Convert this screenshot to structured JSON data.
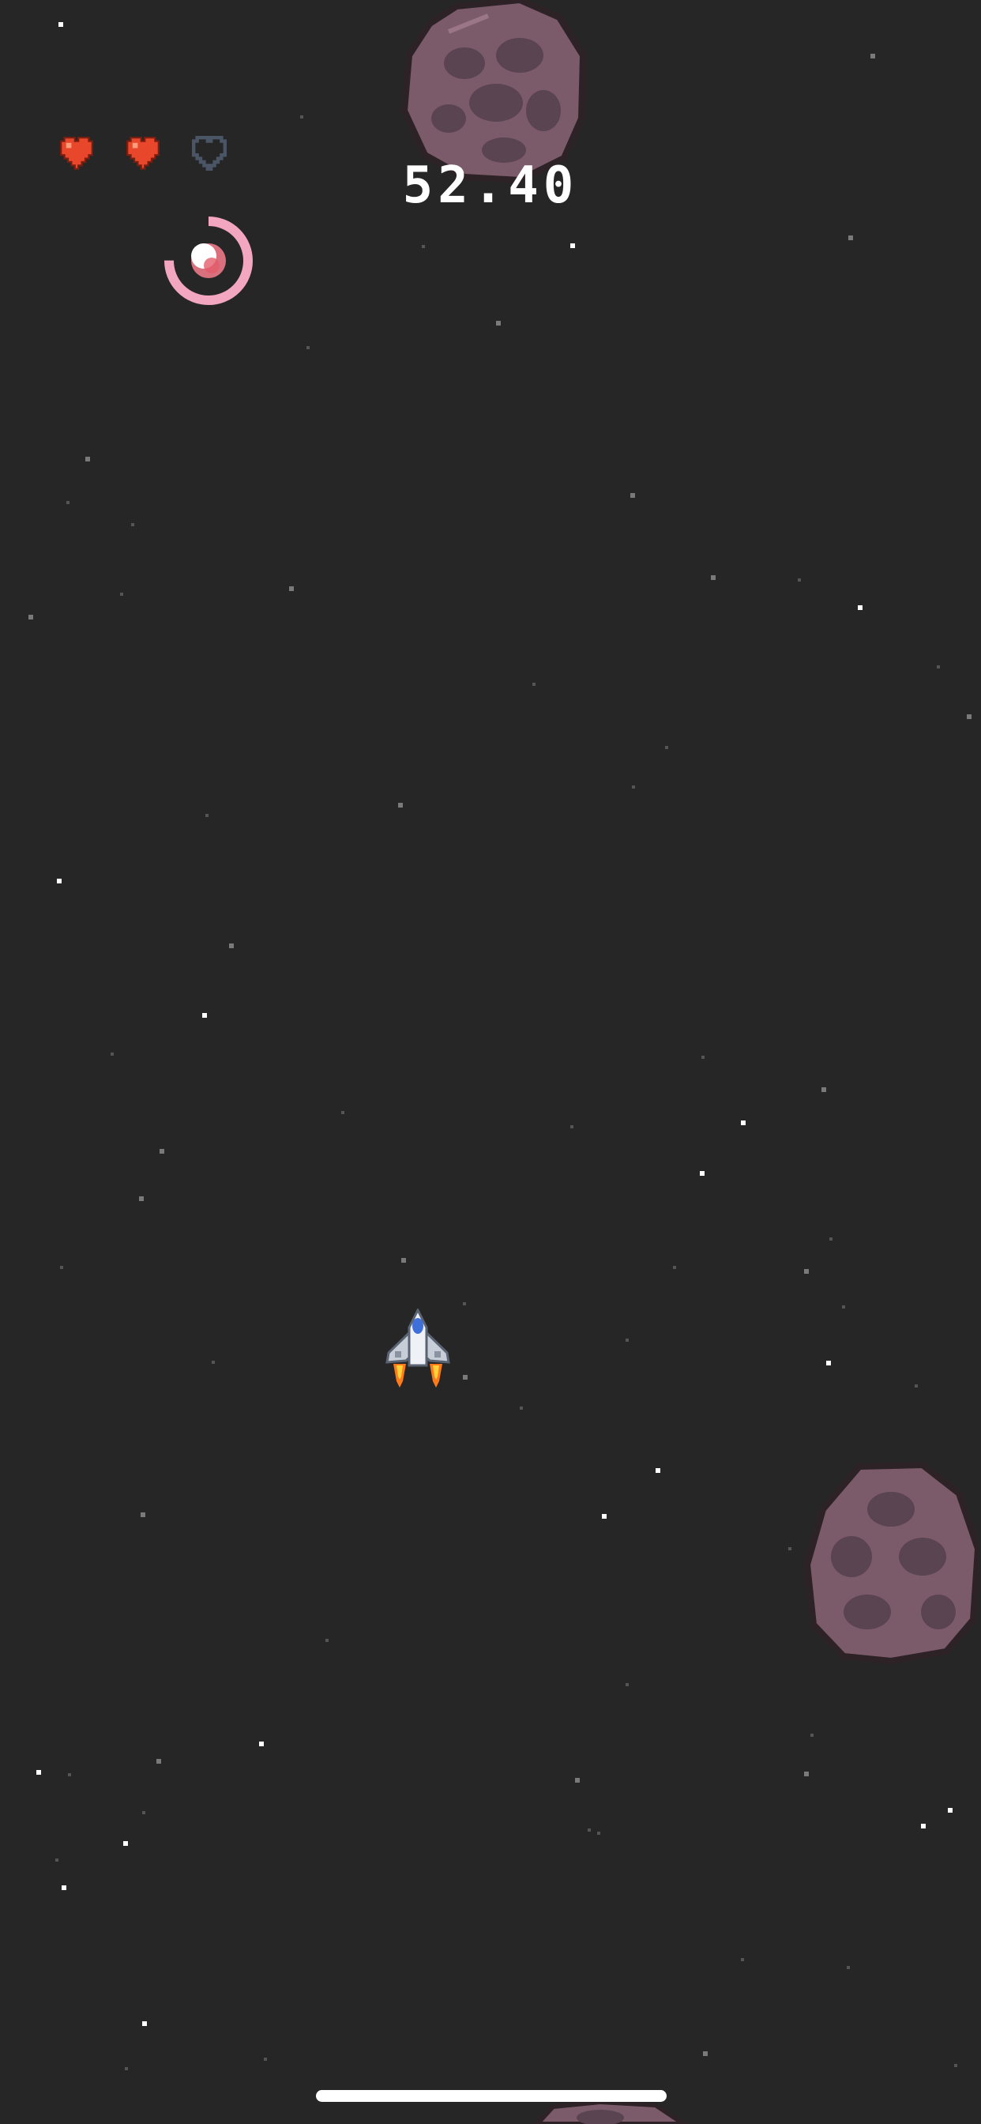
{
  "hud": {
    "timer": "52.40",
    "lives": {
      "max": 3,
      "remaining": 2
    }
  },
  "powerup": {
    "progress": 0.75
  },
  "colors": {
    "background": "#262626",
    "heart_full": "#e8472b",
    "heart_empty": "#4a5566",
    "powerup_ring": "#f3a6c0",
    "asteroid": "#7b5a6a"
  },
  "icons": {
    "heart": "heart-icon",
    "powerup": "shield-orb-icon",
    "ship": "spaceship-icon",
    "asteroid": "asteroid-icon"
  }
}
